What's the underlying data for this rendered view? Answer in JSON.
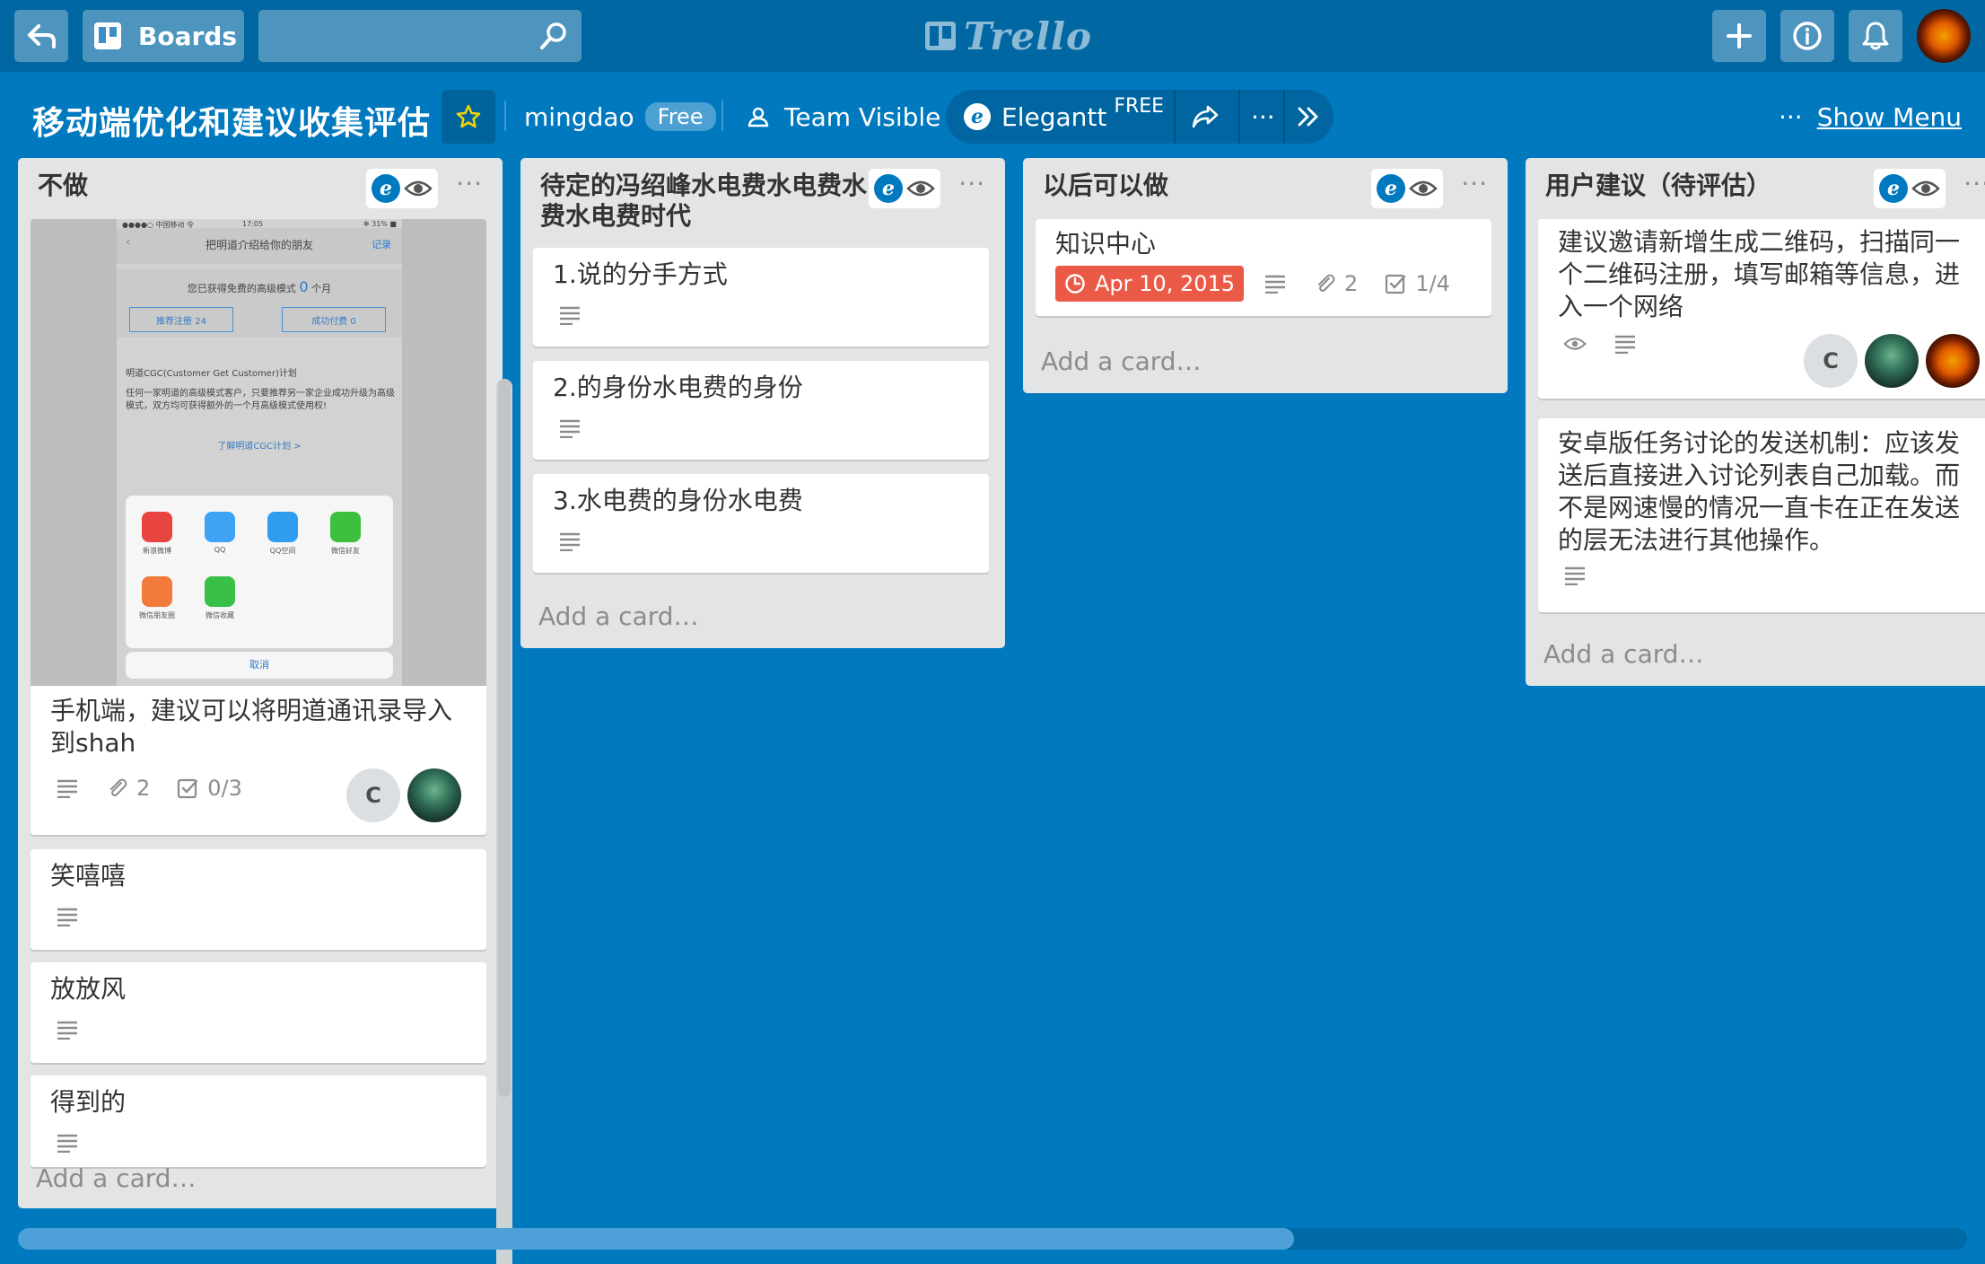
{
  "topbar": {
    "boards_label": "Boards",
    "search_value": "",
    "logo_text": "Trello"
  },
  "board": {
    "title": "移动端优化和建议收集评估",
    "org_name": "mingdao",
    "org_badge": "Free",
    "visibility_label": "Team Visible",
    "powerup_label": "Elegantt",
    "powerup_badge": "FREE",
    "more_label": "···",
    "show_menu_dots": "···",
    "show_menu_label": "Show Menu"
  },
  "lists": [
    {
      "title": "不做",
      "more": "···",
      "cards": [
        {
          "text": "手机端，建议可以将明道通讯录导入到shah",
          "attachments": "2",
          "checklist": "0/3",
          "members": [
            "C",
            "avatar",
            ""
          ],
          "cover": {
            "status_left": "●●●●○ 中国移动 令",
            "status_time": "17:05",
            "status_right": "✻ 31% ■",
            "nav_title": "把明道介绍给你的朋友",
            "nav_right": "记录",
            "earned_text": "您已获得免费的高级模式",
            "earned_num": "0",
            "earned_unit": "个月",
            "chip_register": "推荐注册 24",
            "chip_paid": "成功付费 0",
            "plan_title": "明道CGC(Customer Get Customer)计划",
            "plan_desc": "任何一家明道的高级模式客户，只要推荐另一家企业成功升级为高级模式，双方均可获得额外的一个月高级模式使用权!",
            "plan_link": "了解明道CGC计划 >",
            "apps": [
              "新浪微博",
              "QQ",
              "QQ空间",
              "微信好友",
              "微信朋友圈",
              "微信收藏"
            ],
            "cancel": "取消"
          }
        },
        {
          "text": "笑嘻嘻"
        },
        {
          "text": "放放风"
        },
        {
          "text": "得到的"
        }
      ],
      "add_card": "Add a card…"
    },
    {
      "title": "待定的冯绍峰水电费水电费水电费水电费时代",
      "more": "···",
      "cards": [
        {
          "text": "1.说的分手方式"
        },
        {
          "text": "2.的身份水电费的身份"
        },
        {
          "text": "3.水电费的身份水电费"
        }
      ],
      "add_card": "Add a card…"
    },
    {
      "title": "以后可以做",
      "more": "···",
      "cards": [
        {
          "text": "知识中心",
          "due": "Apr 10, 2015",
          "attachments": "2",
          "checklist": "1/4"
        }
      ],
      "add_card": "Add a card…"
    },
    {
      "title": "用户建议（待评估）",
      "more": "···",
      "cards": [
        {
          "text": "建议邀请新增生成二维码，扫描同一个二维码注册，填写邮箱等信息，进入一个网络",
          "members": [
            "C",
            "",
            ""
          ]
        },
        {
          "text": "安卓版任务讨论的发送机制：应该发送后直接进入讨论列表自己加载。而不是网速慢的情况一直卡在正在发送的层无法进行其他操作。"
        }
      ],
      "add_card": "Add a card…"
    }
  ],
  "colors": {
    "board_bg": "#0079bf",
    "header_bg": "#0067a3",
    "list_bg": "#e2e4e6",
    "due_red": "#eb5a46"
  }
}
